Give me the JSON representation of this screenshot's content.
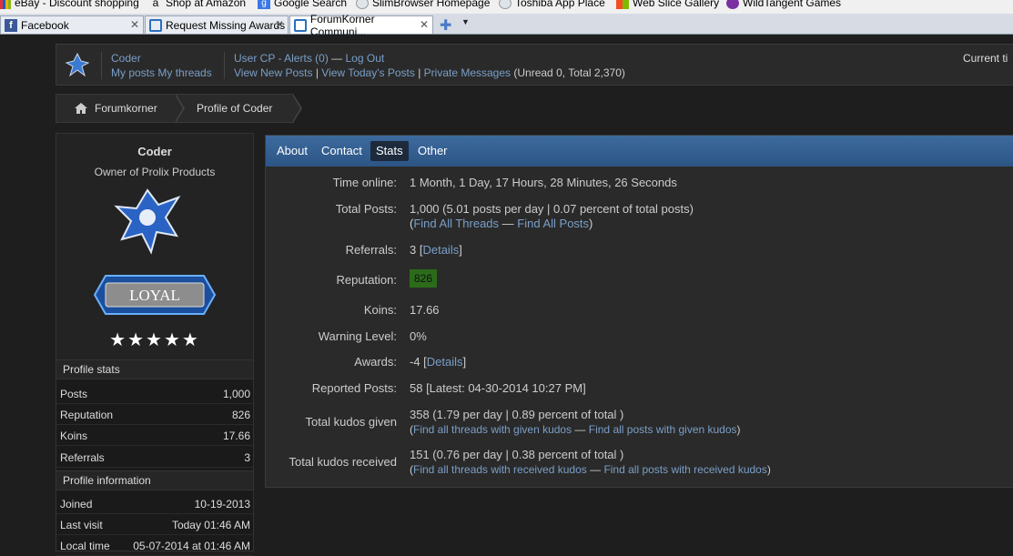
{
  "browser": {
    "bookmarks": [
      "eBay - Discount shopping",
      "Shop at Amazon",
      "Google Search",
      "SlimBrowser Homepage",
      "Toshiba App Place",
      "Web Slice Gallery",
      "WildTangent Games"
    ],
    "tabs": [
      {
        "label": "Facebook"
      },
      {
        "label": "Request Missing Awards"
      },
      {
        "label": "ForumKorner Communi..."
      }
    ]
  },
  "header": {
    "username": "Coder",
    "my_posts": "My posts",
    "my_threads": "My threads",
    "user_cp": "User CP",
    "alerts": "Alerts (0)",
    "log_out": "Log Out",
    "view_new_posts": "View New Posts",
    "view_todays_posts": "View Today's Posts",
    "private_messages": "Private Messages",
    "pm_counts": "(Unread 0, Total 2,370)",
    "current_time": "Current ti"
  },
  "breadcrumb": {
    "home": "Forumkorner",
    "current": "Profile of Coder"
  },
  "profile": {
    "name": "Coder",
    "title": "Owner of Prolix Products",
    "badge_text": "LOYAL",
    "stars": "★★★★★",
    "stats_heading": "Profile stats",
    "stats": [
      {
        "k": "Posts",
        "v": "1,000"
      },
      {
        "k": "Reputation",
        "v": "826"
      },
      {
        "k": "Koins",
        "v": "17.66"
      },
      {
        "k": "Referrals",
        "v": "3"
      }
    ],
    "info_heading": "Profile information",
    "info": [
      {
        "k": "Joined",
        "v": "10-19-2013"
      },
      {
        "k": "Last visit",
        "v": "Today 01:46 AM"
      },
      {
        "k": "Local time",
        "v": "05-07-2014 at 01:46 AM"
      }
    ]
  },
  "tabs": {
    "about": "About",
    "contact": "Contact",
    "stats": "Stats",
    "other": "Other"
  },
  "stats": {
    "time_online_label": "Time online:",
    "time_online": "1 Month, 1 Day, 17 Hours, 28 Minutes, 26 Seconds",
    "total_posts_label": "Total Posts:",
    "total_posts": "1,000 (5.01 posts per day | 0.07 percent of total posts)",
    "find_threads": "Find All Threads",
    "find_posts": "Find All Posts",
    "referrals_label": "Referrals:",
    "referrals": "3",
    "details": "Details",
    "reputation_label": "Reputation:",
    "reputation": "826",
    "koins_label": "Koins:",
    "koins": "17.66",
    "warning_label": "Warning Level:",
    "warning": "0%",
    "awards_label": "Awards:",
    "awards": "-4",
    "reported_label": "Reported Posts:",
    "reported": "58 [Latest: 04-30-2014 10:27 PM]",
    "kudos_given_label": "Total kudos given",
    "kudos_given": "358 (1.79 per day | 0.89 percent of total )",
    "kudos_given_threads": "Find all threads with given kudos",
    "kudos_given_posts": "Find all posts with given kudos",
    "kudos_received_label": "Total kudos received",
    "kudos_received": "151 (0.76 per day | 0.38 percent of total )",
    "kudos_received_threads": "Find all threads with received kudos",
    "kudos_received_posts": "Find all posts with received kudos"
  },
  "colors": {
    "link": "#7a9fc8",
    "tabbar": "#3d6a9e",
    "reputation_bg": "#2b6b1a"
  }
}
